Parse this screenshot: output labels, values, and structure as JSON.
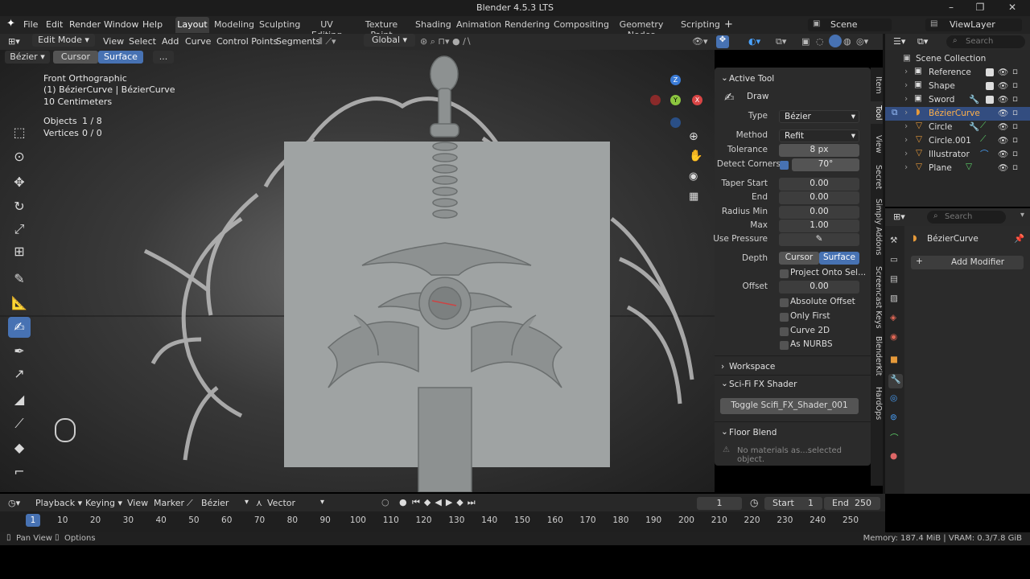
{
  "window": {
    "title": "Blender 4.5.3 LTS"
  },
  "topbar": {
    "menus": [
      "File",
      "Edit",
      "Render",
      "Window",
      "Help"
    ],
    "workspaces": [
      "Layout",
      "Modeling",
      "Sculpting",
      "UV Editing",
      "Texture Paint",
      "Shading",
      "Animation",
      "Rendering",
      "Compositing",
      "Geometry Nodes",
      "Scripting"
    ],
    "active_workspace": "Layout",
    "scene": "Scene",
    "view_layer": "ViewLayer"
  },
  "viewport_header": {
    "mode": "Edit Mode",
    "menus": [
      "View",
      "Select",
      "Add",
      "Curve",
      "Control Points",
      "Segments"
    ],
    "orientation": "Global",
    "curve_type": "Bézier",
    "depth_cursor": "Cursor",
    "depth_surface": "Surface",
    "more": "..."
  },
  "overlay_info": {
    "view_name": "Front Orthographic",
    "object_line": "(1) BézierCurve | BézierCurve",
    "scale": "10 Centimeters",
    "objects_label": "Objects",
    "objects_value": "1 / 8",
    "vertices_label": "Vertices",
    "vertices_value": "0 / 0"
  },
  "gizmo": {
    "z": "Z",
    "y": "Y",
    "x": "X"
  },
  "npanel": {
    "active_tool_header": "Active Tool",
    "tool_name": "Draw",
    "type_label": "Type",
    "type_value": "Bézier",
    "method_label": "Method",
    "method_value": "Refit",
    "tolerance_label": "Tolerance",
    "tolerance_value": "8 px",
    "detect_corners_label": "Detect Corners",
    "detect_corners_value": "70°",
    "taper_start_label": "Taper Start",
    "taper_start_value": "0.00",
    "end_label": "End",
    "end_value": "0.00",
    "radius_min_label": "Radius Min",
    "radius_min_value": "0.00",
    "max_label": "Max",
    "max_value": "1.00",
    "use_pressure_label": "Use Pressure",
    "depth_label": "Depth",
    "depth_cursor": "Cursor",
    "depth_surface": "Surface",
    "project_onto": "Project Onto Sel...",
    "offset_label": "Offset",
    "offset_value": "0.00",
    "absolute_offset": "Absolute Offset",
    "only_first": "Only First",
    "curve_2d": "Curve 2D",
    "as_nurbs": "As NURBS",
    "workspace_header": "Workspace",
    "scifi_header": "Sci-Fi FX Shader",
    "scifi_button": "Toggle Scifi_FX_Shader_001",
    "floor_header": "Floor Blend",
    "floor_msg": "No materials as...selected object."
  },
  "side_tabs": [
    "Item",
    "Tool",
    "View",
    "Secret",
    "Simply Addons",
    "Screencast Keys",
    "BlenderKit",
    "HardOps"
  ],
  "outliner": {
    "search_placeholder": "Search",
    "root": "Scene Collection",
    "items": [
      "Reference",
      "Shape",
      "Sword",
      "BézierCurve",
      "Circle",
      "Circle.001",
      "Illustrator",
      "Plane"
    ]
  },
  "properties": {
    "search_placeholder": "Search",
    "object_name": "BézierCurve",
    "add_modifier": "Add Modifier"
  },
  "timeline": {
    "menus": [
      "Playback",
      "Keying",
      "View",
      "Marker"
    ],
    "interp": "Bézier",
    "easing": "Vector",
    "current_frame": "1",
    "start_label": "Start",
    "start_value": "1",
    "end_label": "End",
    "end_value": "250",
    "ticks": [
      "1",
      "10",
      "20",
      "30",
      "40",
      "50",
      "60",
      "70",
      "80",
      "90",
      "100",
      "110",
      "120",
      "130",
      "140",
      "150",
      "160",
      "170",
      "180",
      "190",
      "200",
      "210",
      "220",
      "230",
      "240",
      "250"
    ]
  },
  "statusbar": {
    "pan": "Pan View",
    "options": "Options",
    "memory": "Memory: 187.4 MiB | VRAM: 0.3/7.8 GiB"
  },
  "colors": {
    "accent": "#4772b3",
    "panel": "#2b2b2b",
    "header": "#232323"
  }
}
